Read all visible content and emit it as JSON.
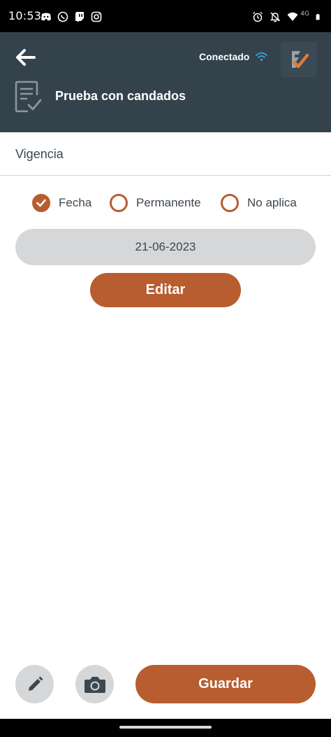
{
  "status_bar": {
    "time": "10:53",
    "left_icons": [
      "discord-icon",
      "whatsapp-icon",
      "twitch-icon",
      "instagram-icon"
    ],
    "right_icons": [
      "alarm-icon",
      "notifications-off-icon",
      "wifi-icon",
      "network-4g-icon",
      "battery-icon"
    ],
    "network_label": "4G"
  },
  "header": {
    "connection_status": "Conectado",
    "title": "Prueba con candados",
    "background_color": "#34424c",
    "wifi_color": "#2b9fd9"
  },
  "section": {
    "title": "Vigencia"
  },
  "options": [
    {
      "label": "Fecha",
      "checked": true
    },
    {
      "label": "Permanente",
      "checked": false
    },
    {
      "label": "No aplica",
      "checked": false
    }
  ],
  "date_field": {
    "value": "21-06-2023"
  },
  "buttons": {
    "edit_label": "Editar",
    "save_label": "Guardar"
  },
  "colors": {
    "accent": "#b85d2f",
    "field_bg": "#d5d7d8",
    "text": "#3d4750"
  }
}
